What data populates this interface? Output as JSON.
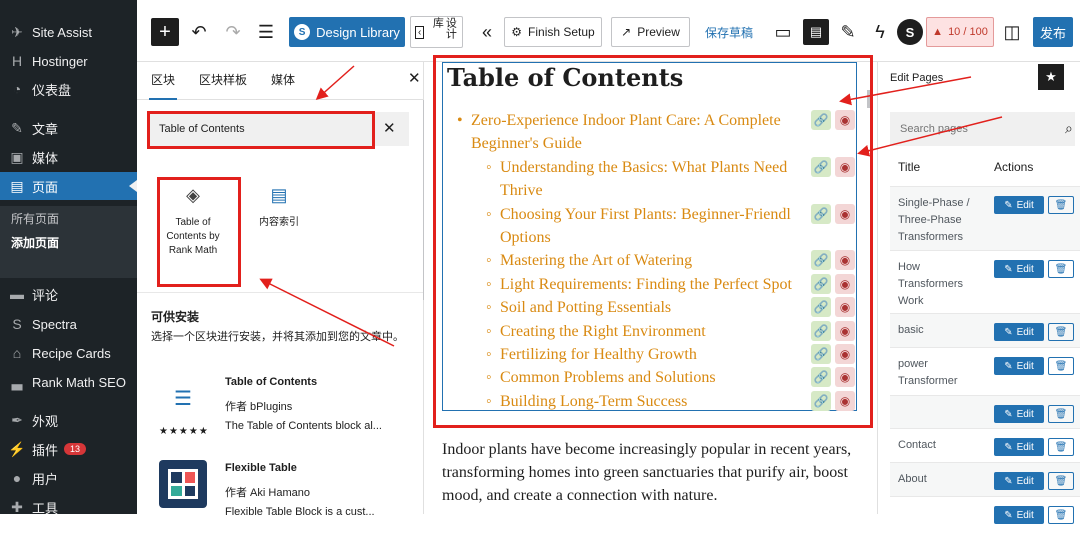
{
  "wp_sidebar": {
    "items": [
      {
        "label": "Site Assist",
        "icon": "rocket-icon"
      },
      {
        "label": "Hostinger",
        "icon": "hostinger-icon"
      },
      {
        "label": "仪表盘",
        "icon": "dashboard-icon"
      },
      {
        "label": "文章",
        "icon": "pin-icon"
      },
      {
        "label": "媒体",
        "icon": "media-icon"
      },
      {
        "label": "页面",
        "icon": "page-icon"
      },
      {
        "label": "评论",
        "icon": "comment-icon"
      },
      {
        "label": "Spectra",
        "icon": "spectra-icon"
      },
      {
        "label": "Recipe Cards",
        "icon": "recipe-icon"
      },
      {
        "label": "Rank Math SEO",
        "icon": "chart-icon"
      },
      {
        "label": "外观",
        "icon": "brush-icon"
      },
      {
        "label": "插件",
        "icon": "plugin-icon",
        "badge": "13"
      },
      {
        "label": "用户",
        "icon": "user-icon"
      },
      {
        "label": "工具",
        "icon": "wrench-icon"
      }
    ],
    "sub_items": [
      "所有页面",
      "添加页面"
    ]
  },
  "toolbar": {
    "design_library": "Design Library",
    "settings_vertical": "设计库",
    "finish_setup": "Finish Setup",
    "preview": "Preview",
    "save_draft": "保存草稿",
    "score": "10 / 100",
    "publish": "发布"
  },
  "inserter": {
    "tabs": [
      "区块",
      "区块样板",
      "媒体"
    ],
    "search_value": "Table of Contents",
    "blocks": [
      {
        "label": "Table of Contents by Rank Math",
        "icon": "layers-icon"
      },
      {
        "label": "内容索引",
        "icon": "toc-block-icon"
      }
    ],
    "install_heading": "可供安装",
    "install_desc": "选择一个区块进行安装，并将其添加到您的文章中。",
    "plugins": [
      {
        "name": "Table of Contents",
        "author": "作者 bPlugins",
        "desc": "The Table of Contents block al...",
        "stars": "★★★★★"
      },
      {
        "name": "Flexible Table",
        "author": "作者 Aki Hamano",
        "desc": "Flexible Table Block is a cust...",
        "stars": "★★★★★"
      }
    ]
  },
  "editor": {
    "toc_title": "Table of Contents",
    "toc_items": [
      {
        "text": "Zero-Experience Indoor Plant Care: A Complete",
        "level": 1
      },
      {
        "text": "Beginner's Guide",
        "level": 1,
        "cont": true
      },
      {
        "text": "Understanding the Basics: What Plants Need",
        "level": 2
      },
      {
        "text": "Thrive",
        "level": 2,
        "cont": true
      },
      {
        "text": "Choosing Your First Plants: Beginner-Friendl",
        "level": 2
      },
      {
        "text": "Options",
        "level": 2,
        "cont": true
      },
      {
        "text": "Mastering the Art of Watering",
        "level": 2
      },
      {
        "text": "Light Requirements: Finding the Perfect Spot",
        "level": 2
      },
      {
        "text": "Soil and Potting Essentials",
        "level": 2
      },
      {
        "text": "Creating the Right Environment",
        "level": 2
      },
      {
        "text": "Fertilizing for Healthy Growth",
        "level": 2
      },
      {
        "text": "Common Problems and Solutions",
        "level": 2
      },
      {
        "text": "Building Long-Term Success",
        "level": 2
      }
    ],
    "paragraph": "Indoor plants have become increasingly popular in recent years, transforming homes into green sanctuaries that purify air, boost mood, and create a connection with nature."
  },
  "right_panel": {
    "title": "Edit Pages",
    "search_placeholder": "Search pages",
    "col_title": "Title",
    "col_actions": "Actions",
    "edit_label": "Edit",
    "rows": [
      "Single-Phase / Three-Phase Transformers",
      "How Transformers Work",
      "basic",
      "power Transformer",
      "",
      "Contact",
      "About",
      ""
    ]
  },
  "colors": {
    "wp_dark": "#1d2327",
    "accent": "#2271b1",
    "toc_link": "#d98a12",
    "annotation": "#e2201c"
  }
}
